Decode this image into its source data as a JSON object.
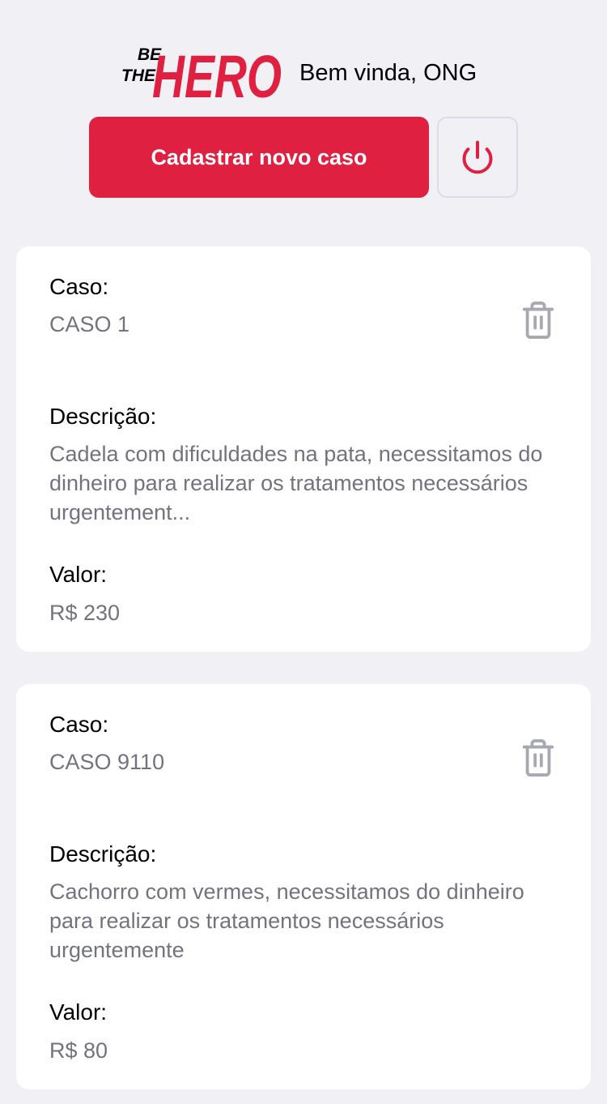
{
  "header": {
    "logo": {
      "line1": "BE",
      "line2": "THE",
      "word": "HERO"
    },
    "welcome_text": "Bem vinda, ONG",
    "new_case_label": "Cadastrar novo caso",
    "logout_icon": "power-icon"
  },
  "colors": {
    "brand": "#e02041",
    "background": "#f0f0f5",
    "card": "#ffffff",
    "muted_text": "#737380",
    "icon_gray": "#a8a8b3"
  },
  "cases": [
    {
      "caso_label": "Caso:",
      "caso_value": "CASO 1",
      "descricao_label": "Descrição:",
      "descricao_value": "Cadela com dificuldades na pata, necessitamos do dinheiro para realizar os tratamentos necessários urgentement...",
      "valor_label": "Valor:",
      "valor_value": "R$ 230",
      "delete_icon": "trash-icon"
    },
    {
      "caso_label": "Caso:",
      "caso_value": "CASO 9110",
      "descricao_label": "Descrição:",
      "descricao_value": "Cachorro com vermes, necessitamos do dinheiro para realizar os tratamentos necessários urgentemente",
      "valor_label": "Valor:",
      "valor_value": "R$ 80",
      "delete_icon": "trash-icon"
    }
  ]
}
